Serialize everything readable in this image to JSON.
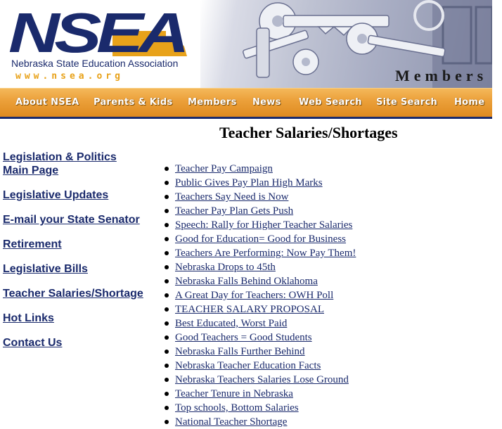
{
  "header": {
    "logo_text": "NSEA",
    "tagline": "Nebraska State Education Association",
    "url_text": "www.nsea.org",
    "section_title": "Members"
  },
  "nav": {
    "items": [
      {
        "label": "About NSEA"
      },
      {
        "label": "Parents & Kids"
      },
      {
        "label": "Members"
      },
      {
        "label": "News"
      },
      {
        "label": "Web Search"
      },
      {
        "label": "Site Search"
      },
      {
        "label": "Home"
      }
    ]
  },
  "sidebar": {
    "links": [
      {
        "label": "Legislation & Politics Main Page"
      },
      {
        "label": "Legislative Updates"
      },
      {
        "label": "E-mail your State Senator"
      },
      {
        "label": "Retirement"
      },
      {
        "label": "Legislative Bills"
      },
      {
        "label": "Teacher Salaries/Shortage"
      },
      {
        "label": "Hot Links"
      },
      {
        "label": "Contact Us"
      }
    ]
  },
  "main": {
    "title": "Teacher Salaries/Shortages",
    "articles": [
      "Teacher Pay Campaign",
      "Public Gives Pay Plan High Marks",
      "Teachers Say Need is Now",
      "Teacher Pay Plan Gets Push",
      "Speech: Rally for Higher Teacher Salaries",
      "Good for Education= Good for Business",
      "Teachers Are Performing: Now Pay Them!",
      "Nebraska Drops to 45th",
      "Nebraska Falls Behind Oklahoma",
      "A Great Day for Teachers: OWH Poll",
      "TEACHER SALARY PROPOSAL",
      "Best Educated, Worst Paid",
      "Good Teachers = Good Students",
      "Nebraska Falls Further Behind",
      "Nebraska Teacher Education Facts",
      "Nebraska Teachers Salaries Lose Ground",
      "Teacher Tenure in Nebraska",
      "Top schools, Bottom Salaries",
      "National Teacher Shortage"
    ]
  },
  "colors": {
    "brand_navy": "#1a2a6c",
    "brand_gold": "#e8a21a",
    "nav_orange": "#eca13b"
  }
}
